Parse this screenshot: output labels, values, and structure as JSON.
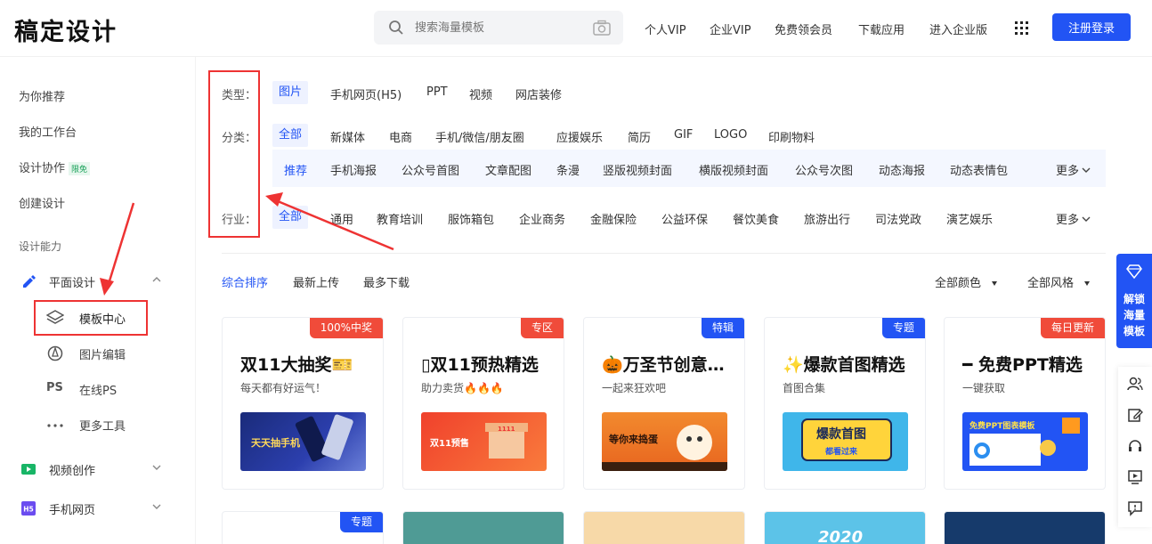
{
  "header": {
    "logo": "稿定设计",
    "search_placeholder": "搜索海量模板",
    "nav": [
      "个人VIP",
      "企业VIP",
      "免费领会员",
      "下载应用",
      "进入企业版"
    ],
    "login": "注册登录"
  },
  "sidebar": {
    "top_items": [
      "为你推荐",
      "我的工作台",
      "设计协作",
      "创建设计"
    ],
    "collab_badge": "限免",
    "section_label": "设计能力",
    "graphic": {
      "label": "平面设计",
      "sub": [
        "模板中心",
        "图片编辑",
        "在线PS",
        "更多工具"
      ],
      "ps_glyph": "PS"
    },
    "video": "视频创作",
    "h5": "手机网页",
    "h5_glyph": "H5"
  },
  "filters": {
    "type_label": "类型：",
    "types": [
      "图片",
      "手机网页(H5)",
      "PPT",
      "视频",
      "网店装修"
    ],
    "cat_label": "分类：",
    "cats": [
      "全部",
      "新媒体",
      "电商",
      "手机/微信/朋友圈",
      "应援娱乐",
      "简历",
      "GIF",
      "LOGO",
      "印刷物料"
    ],
    "subcats": [
      "推荐",
      "手机海报",
      "公众号首图",
      "文章配图",
      "条漫",
      "竖版视频封面",
      "横版视频封面",
      "公众号次图",
      "动态海报",
      "动态表情包"
    ],
    "more": "更多",
    "industry_label": "行业：",
    "industries": [
      "全部",
      "通用",
      "教育培训",
      "服饰箱包",
      "企业商务",
      "金融保险",
      "公益环保",
      "餐饮美食",
      "旅游出行",
      "司法党政",
      "演艺娱乐"
    ]
  },
  "sort": {
    "options": [
      "综合排序",
      "最新上传",
      "最多下载"
    ],
    "color": "全部颜色",
    "style": "全部风格"
  },
  "cards": [
    {
      "tag": "100%中奖",
      "tag_color": "#f04b3a",
      "title": "双11大抽奖🎫",
      "sub": "每天都有好运气！",
      "thumb_text": "天天抽手机"
    },
    {
      "tag": "专区",
      "tag_color": "#f04b3a",
      "title": "▯双11预热精选",
      "sub": "助力卖货🔥🔥🔥",
      "thumb_text": "双11预售",
      "thumb_text2": "1111"
    },
    {
      "tag": "特辑",
      "tag_color": "#2254f4",
      "title": "🎃万圣节创意…",
      "sub": "一起来狂欢吧",
      "thumb_text": "等你来捣蛋"
    },
    {
      "tag": "专题",
      "tag_color": "#2254f4",
      "title": "✨爆款首图精选",
      "sub": "首图合集",
      "thumb_text": "爆款首图",
      "thumb_text2": "都看过来"
    },
    {
      "tag": "每日更新",
      "tag_color": "#f04b3a",
      "title": "━ 免费PPT精选",
      "sub": "一键获取",
      "thumb_text": "免费PPT图表模板"
    }
  ],
  "row2": {
    "tag": "专题",
    "text2020": "2020"
  },
  "float": {
    "promo": [
      "解锁",
      "海量",
      "模板"
    ]
  }
}
